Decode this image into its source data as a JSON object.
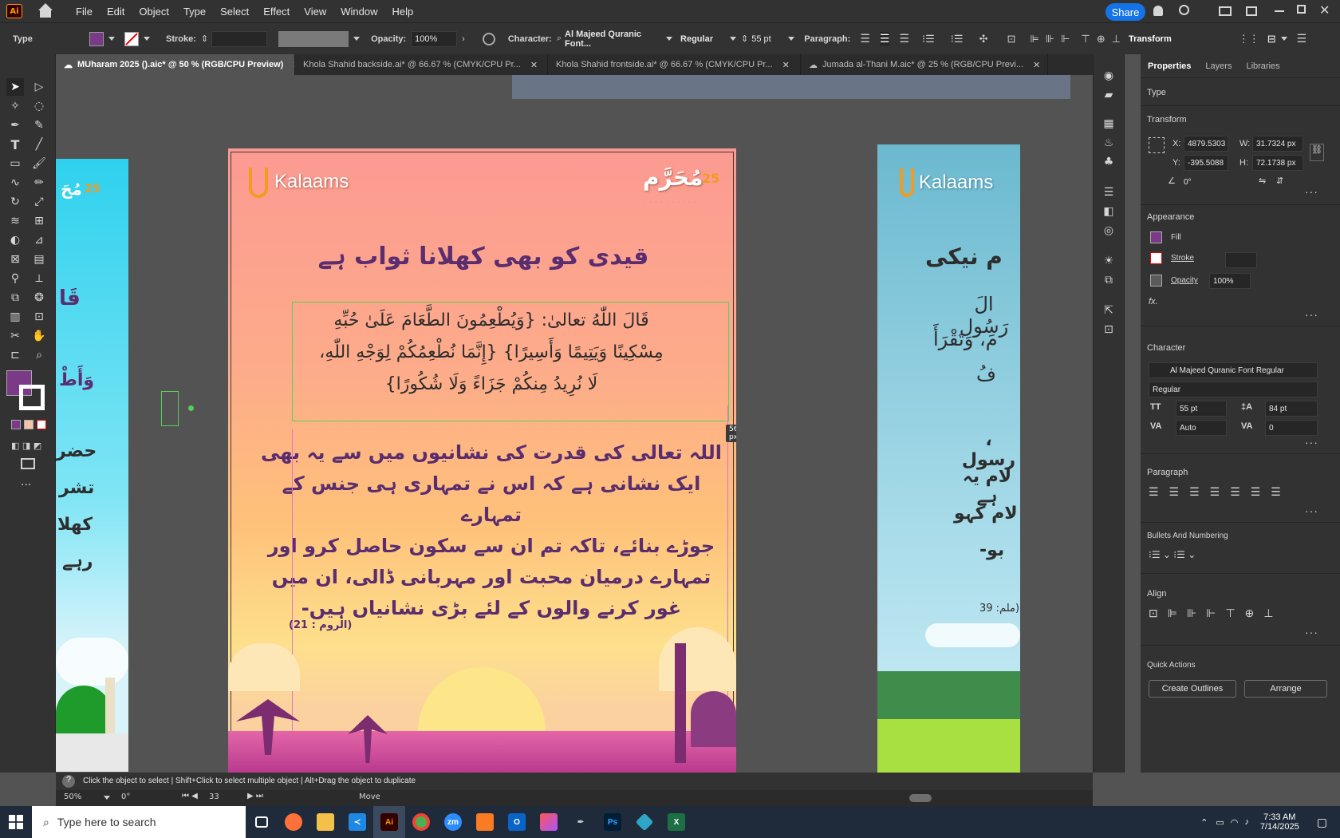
{
  "app": {
    "logo": "Ai",
    "menu": [
      "File",
      "Edit",
      "Object",
      "Type",
      "Select",
      "Effect",
      "View",
      "Window",
      "Help"
    ],
    "share_label": "Share"
  },
  "control_bar": {
    "type_label": "Type",
    "stroke_label": "Stroke:",
    "opacity_label": "Opacity:",
    "opacity_value": "100%",
    "character_label": "Character:",
    "font_name": "Al Majeed Quranic Font...",
    "font_style": "Regular",
    "font_size": "55 pt",
    "paragraph_label": "Paragraph:",
    "transform_label": "Transform",
    "fill_color": "#7b3a87"
  },
  "tabs": [
    {
      "label": "MUharam 2025 ().aic* @ 50 % (RGB/CPU Preview)",
      "active": true
    },
    {
      "label": "Khola Shahid backside.ai* @ 66.67 % (CMYK/CPU Pr...",
      "active": false
    },
    {
      "label": "Khola Shahid frontside.ai* @ 66.67 % (CMYK/CPU Pr...",
      "active": false
    },
    {
      "label": "Jumada al-Thani M.aic* @ 25 % (RGB/CPU Previ...",
      "active": false
    }
  ],
  "artboards": {
    "left": {
      "number": "25",
      "heading_partial": "مُحَ",
      "lines": [
        "قَا",
        "",
        "وَأَطْ",
        "",
        "حضر",
        "تشر",
        "کھلا",
        "رہے"
      ]
    },
    "main": {
      "brand": "Kalaams",
      "muharram": "مُحَرَّم",
      "number": "25",
      "title": "قیدی کو بھی کھلانا ثواب ہے",
      "arabic": [
        "قَالَ اللّٰهُ تعالیٰ: {وَيُطْعِمُونَ الطَّعَامَ عَلَىٰ حُبِّهِ",
        "مِسْكِينًا وَيَتِيمًا وَأَسِيرًا} {إِنَّمَا نُطْعِمُكُمْ لِوَجْهِ اللّٰهِ،",
        "لَا نُرِيدُ مِنكُمْ جَزَاءً وَلَا شُكُورًا}"
      ],
      "urdu": [
        "اللہ تعالی کی قدرت کی نشانیوں میں سے یہ بھی",
        "ایک نشانی ہے کہ اس نے تمہاری ہی جنس کے تمہارے",
        "جوڑے بنائے، تاکہ تم ان سے سکون حاصل کرو اور",
        "تمہارے درمیان محبت اور مہربانی ڈالی، ان میں",
        "غور کرنے والوں کے لئے بڑی نشانیاں ہیں-"
      ],
      "reference": "(الروم : 21)",
      "measure": "56.3 px"
    },
    "right": {
      "brand": "Kalaams",
      "title_partial": "م نیکی",
      "lines": [
        "الَ رَسُول",
        "مَ، وَتَقْرَأَ",
        "فُ",
        "، رسول",
        "لام یہ ہے",
        "لام کہو",
        "بو-"
      ],
      "reference": "ملم: 39)"
    }
  },
  "properties": {
    "tabs": [
      "Properties",
      "Layers",
      "Libraries"
    ],
    "type_label": "Type",
    "transform_label": "Transform",
    "x_label": "X:",
    "x": "4879.5303",
    "y_label": "Y:",
    "y": "-395.5088",
    "w_label": "W:",
    "w": "31.7324 px",
    "h_label": "H:",
    "h": "72.1738 px",
    "angle": "0°",
    "appearance_label": "Appearance",
    "fill_label": "Fill",
    "stroke_label": "Stroke",
    "opacity_label": "Opacity",
    "opacity": "100%",
    "fx": "fx.",
    "character_label": "Character",
    "font": "Al Majeed Quranic Font Regular",
    "style": "Regular",
    "size": "55 pt",
    "leading": "84 pt",
    "kerning": "Auto",
    "tracking": "0",
    "paragraph_label": "Paragraph",
    "bullets_label": "Bullets And Numbering",
    "align_label": "Align",
    "quick_actions_label": "Quick Actions",
    "create_outlines": "Create Outlines",
    "arrange": "Arrange"
  },
  "status": {
    "hint": "Click the object to select  |  Shift+Click to select multiple object  |  Alt+Drag the object to duplicate",
    "zoom": "50%",
    "rotate": "0°",
    "artboard": "33",
    "tool": "Move"
  },
  "taskbar": {
    "search_placeholder": "Type here to search",
    "time": "7:33 AM",
    "date": "7/14/2025"
  }
}
